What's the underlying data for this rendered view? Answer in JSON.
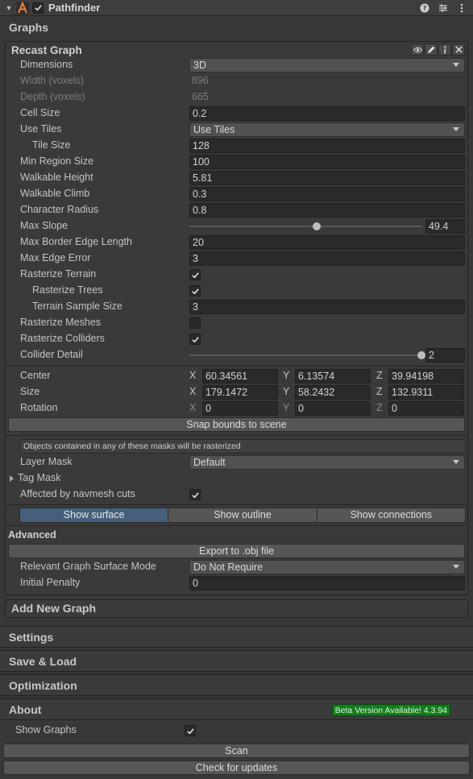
{
  "component": {
    "title": "Pathfinder",
    "enabled": true,
    "header_icons": [
      "help-icon",
      "presets-icon",
      "menu-icon"
    ]
  },
  "sections": {
    "graphs": "Graphs",
    "settings": "Settings",
    "save_load": "Save & Load",
    "optimization": "Optimization",
    "about": "About"
  },
  "graph": {
    "title": "Recast Graph",
    "tool_icons": [
      "eye-icon",
      "pencil-icon",
      "info-icon",
      "close-icon"
    ],
    "dimensions": {
      "label": "Dimensions",
      "value": "3D"
    },
    "width": {
      "label": "Width (voxels)",
      "value": "896"
    },
    "depth": {
      "label": "Depth (voxels)",
      "value": "665"
    },
    "cell_size": {
      "label": "Cell Size",
      "value": "0.2"
    },
    "use_tiles": {
      "label": "Use Tiles",
      "value": "Use Tiles"
    },
    "tile_size": {
      "label": "Tile Size",
      "value": "128"
    },
    "min_region_size": {
      "label": "Min Region Size",
      "value": "100"
    },
    "walkable_height": {
      "label": "Walkable Height",
      "value": "5.81"
    },
    "walkable_climb": {
      "label": "Walkable Climb",
      "value": "0.3"
    },
    "character_radius": {
      "label": "Character Radius",
      "value": "0.8"
    },
    "max_slope": {
      "label": "Max Slope",
      "value": "49.4",
      "fraction": 0.55
    },
    "max_border_edge_length": {
      "label": "Max Border Edge Length",
      "value": "20"
    },
    "max_edge_error": {
      "label": "Max Edge Error",
      "value": "3"
    },
    "rasterize_terrain": {
      "label": "Rasterize Terrain",
      "checked": true
    },
    "rasterize_trees": {
      "label": "Rasterize Trees",
      "checked": true
    },
    "terrain_sample_size": {
      "label": "Terrain Sample Size",
      "value": "3"
    },
    "rasterize_meshes": {
      "label": "Rasterize Meshes",
      "checked": false
    },
    "rasterize_colliders": {
      "label": "Rasterize Colliders",
      "checked": true
    },
    "collider_detail": {
      "label": "Collider Detail",
      "value": "2",
      "fraction": 1.0
    },
    "center": {
      "label": "Center",
      "x": "60.34561",
      "y": "6.13574",
      "z": "39.94198"
    },
    "size": {
      "label": "Size",
      "x": "179.1472",
      "y": "58.2432",
      "z": "132.9311"
    },
    "rotation": {
      "label": "Rotation",
      "x": "0",
      "y": "0",
      "z": "0"
    },
    "axes": {
      "x": "X",
      "y": "Y",
      "z": "Z"
    },
    "snap_bounds_button": "Snap bounds to scene",
    "mask_help": "Objects contained in any of these masks will be rasterized",
    "layer_mask": {
      "label": "Layer Mask",
      "value": "Default"
    },
    "tag_mask": {
      "label": "Tag Mask"
    },
    "affected_by_navmesh_cuts": {
      "label": "Affected by navmesh cuts",
      "checked": true
    },
    "view_tabs": [
      "Show surface",
      "Show outline",
      "Show connections"
    ],
    "active_tab": 0,
    "advanced": {
      "title": "Advanced",
      "export_button": "Export to .obj file",
      "surface_mode": {
        "label": "Relevant Graph Surface Mode",
        "value": "Do Not Require"
      },
      "initial_penalty": {
        "label": "Initial Penalty",
        "value": "0"
      }
    }
  },
  "add_new_graph": "Add New Graph",
  "about": {
    "beta_badge": "Beta Version Available! 4.3.94",
    "show_graphs": {
      "label": "Show Graphs",
      "checked": true
    },
    "scan_button": "Scan",
    "check_updates_button": "Check for updates"
  },
  "colors": {
    "background": "#383838",
    "field": "#2a2a2a",
    "active_tab": "#46607c",
    "beta_badge": "#157b1d"
  }
}
